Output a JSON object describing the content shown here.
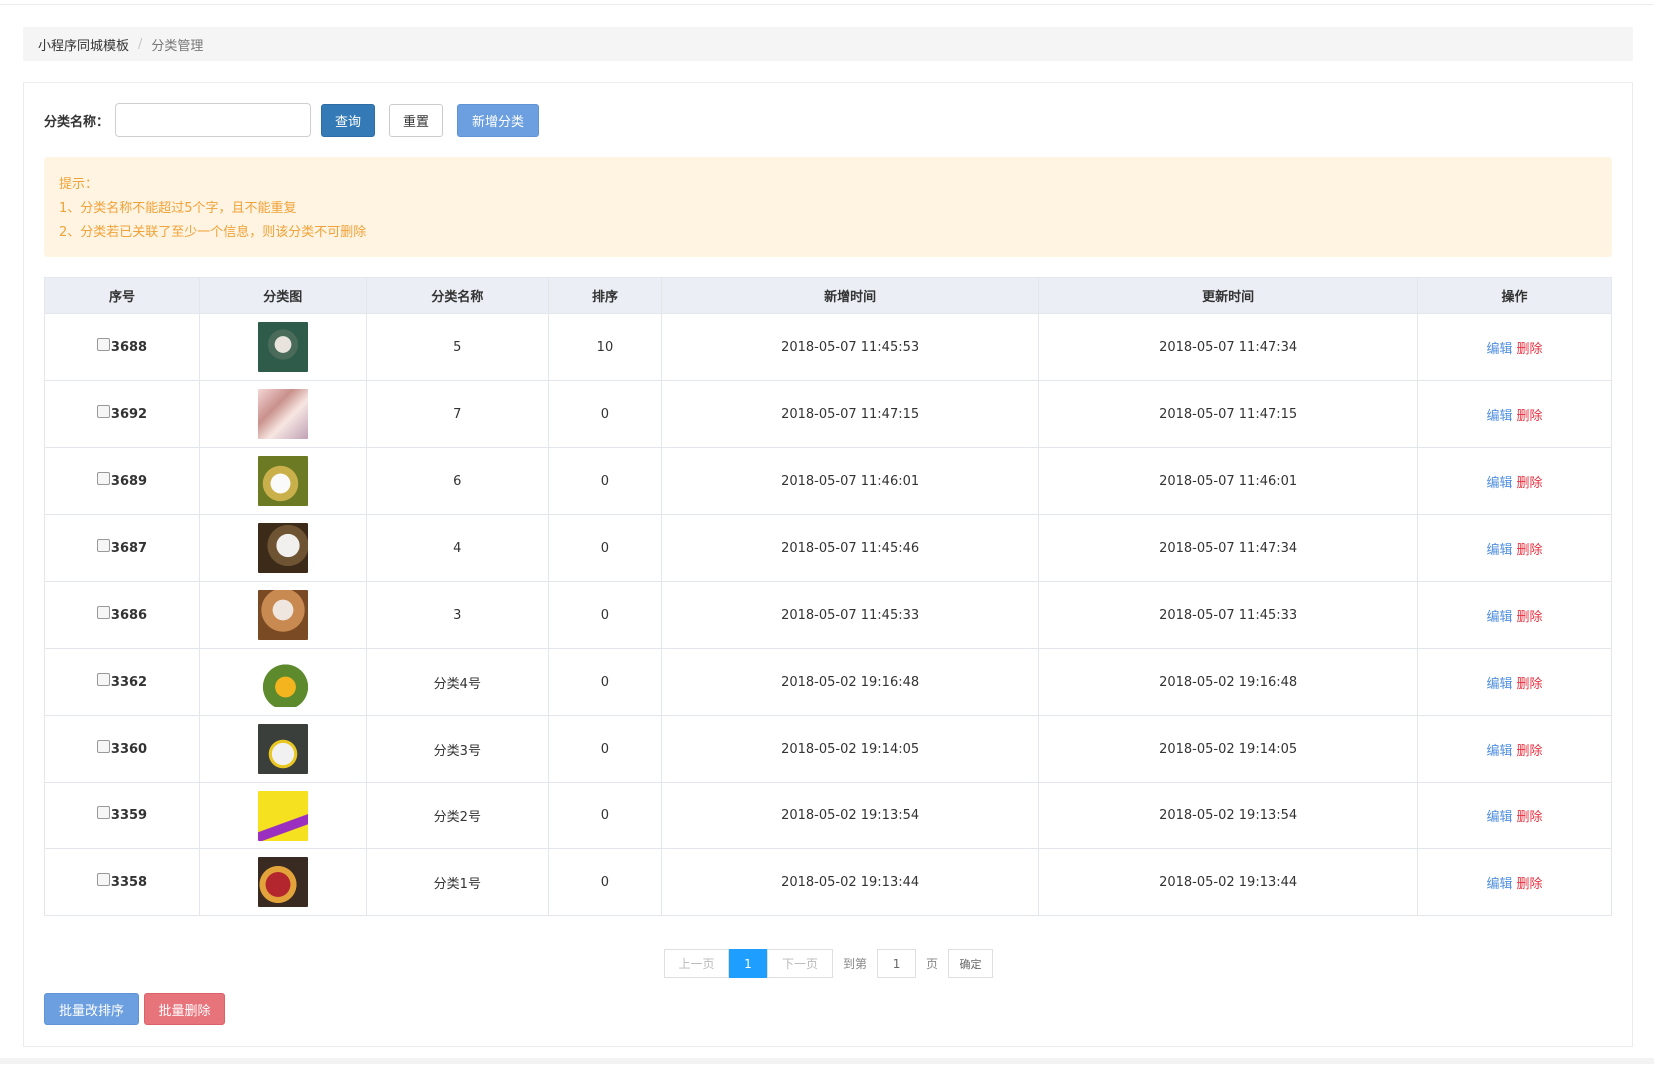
{
  "breadcrumb": {
    "root": "小程序同城模板",
    "separator": "/",
    "current": "分类管理"
  },
  "search": {
    "label": "分类名称：",
    "placeholder": "",
    "value": ""
  },
  "buttons": {
    "query": "查询",
    "reset": "重置",
    "add": "新增分类"
  },
  "tip": {
    "title": "提示：",
    "line1": "1、分类名称不能超过5个字，且不能重复",
    "line2": "2、分类若已关联了至少一个信息，则该分类不可删除"
  },
  "table": {
    "headers": [
      "序号",
      "分类图",
      "分类名称",
      "排序",
      "新增时间",
      "更新时间",
      "操作"
    ],
    "rows": [
      {
        "id": "3688",
        "image": "rabbit-photo",
        "name": "5",
        "sort": "10",
        "created": "2018-05-07 11:45:53",
        "updated": "2018-05-07 11:47:34"
      },
      {
        "id": "3692",
        "image": "girl-photo",
        "name": "7",
        "sort": "0",
        "created": "2018-05-07 11:47:15",
        "updated": "2018-05-07 11:47:15"
      },
      {
        "id": "3689",
        "image": "kitten-photo",
        "name": "6",
        "sort": "0",
        "created": "2018-05-07 11:46:01",
        "updated": "2018-05-07 11:46:01"
      },
      {
        "id": "3687",
        "image": "cat-photo",
        "name": "4",
        "sort": "0",
        "created": "2018-05-07 11:45:46",
        "updated": "2018-05-07 11:47:34"
      },
      {
        "id": "3686",
        "image": "cat-basket-photo",
        "name": "3",
        "sort": "0",
        "created": "2018-05-07 11:45:33",
        "updated": "2018-05-07 11:45:33"
      },
      {
        "id": "3362",
        "image": "jackfruit-photo",
        "name": "分类4号",
        "sort": "0",
        "created": "2018-05-02 19:16:48",
        "updated": "2018-05-02 19:16:48"
      },
      {
        "id": "3360",
        "image": "rabbit-flowers-photo",
        "name": "分类3号",
        "sort": "0",
        "created": "2018-05-02 19:14:05",
        "updated": "2018-05-02 19:14:05"
      },
      {
        "id": "3359",
        "image": "yellow-poster",
        "name": "分类2号",
        "sort": "0",
        "created": "2018-05-02 19:13:54",
        "updated": "2018-05-02 19:13:54"
      },
      {
        "id": "3358",
        "image": "fruits-photo",
        "name": "分类1号",
        "sort": "0",
        "created": "2018-05-02 19:13:44",
        "updated": "2018-05-02 19:13:44"
      }
    ],
    "actions": {
      "edit": "编辑",
      "delete": "删除"
    }
  },
  "pagination": {
    "prev": "上一页",
    "current": "1",
    "next": "下一页",
    "goto_label": "到第",
    "page_input": "1",
    "page_unit": "页",
    "confirm": "确定"
  },
  "bulk": {
    "sort": "批量改排序",
    "delete": "批量删除"
  },
  "colors": {
    "primary": "#337ab7",
    "accent": "#6c9fdf",
    "danger": "#e7737b",
    "tip_bg": "#fff4e2",
    "tip_text": "#f0a238",
    "link": "#4f8fe0",
    "link_danger": "#e8303e",
    "page_active": "#1e9fff"
  }
}
